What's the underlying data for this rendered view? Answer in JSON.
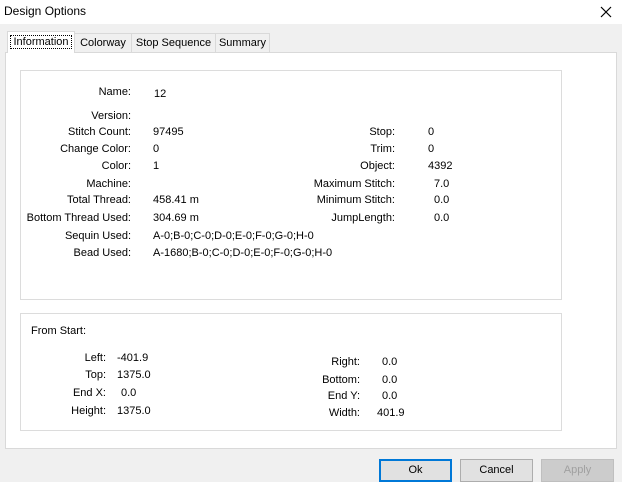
{
  "window": {
    "title": "Design Options"
  },
  "tabs": [
    {
      "label": "Information"
    },
    {
      "label": "Colorway"
    },
    {
      "label": "Stop Sequence"
    },
    {
      "label": "Summary"
    }
  ],
  "info": {
    "name_label": "Name:",
    "name_value": "12",
    "version_label": "Version:",
    "version_value": "",
    "stitch_count_label": "Stitch Count:",
    "stitch_count_value": "97495",
    "change_color_label": "Change Color:",
    "change_color_value": "0",
    "color_label": "Color:",
    "color_value": "1",
    "machine_label": "Machine:",
    "machine_value": "",
    "total_thread_label": "Total Thread:",
    "total_thread_value": "458.41 m",
    "bottom_thread_label": "Bottom Thread Used:",
    "bottom_thread_value": "304.69 m",
    "sequin_label": "Sequin Used:",
    "sequin_value": "A-0;B-0;C-0;D-0;E-0;F-0;G-0;H-0",
    "bead_label": "Bead Used:",
    "bead_value": "A-1680;B-0;C-0;D-0;E-0;F-0;G-0;H-0",
    "stop_label": "Stop:",
    "stop_value": "0",
    "trim_label": "Trim:",
    "trim_value": "0",
    "object_label": "Object:",
    "object_value": "4392",
    "max_stitch_label": "Maximum Stitch:",
    "max_stitch_value": "7.0",
    "min_stitch_label": "Minimum Stitch:",
    "min_stitch_value": "0.0",
    "jump_length_label": "JumpLength:",
    "jump_length_value": "0.0"
  },
  "from_start": {
    "heading": "From Start:",
    "left_label": "Left:",
    "left_value": "-401.9",
    "top_label": "Top:",
    "top_value": "1375.0",
    "endx_label": "End X:",
    "endx_value": "0.0",
    "height_label": "Height:",
    "height_value": "1375.0",
    "right_label": "Right:",
    "right_value": "0.0",
    "bottom_label": "Bottom:",
    "bottom_value": "0.0",
    "endy_label": "End Y:",
    "endy_value": "0.0",
    "width_label": "Width:",
    "width_value": "401.9"
  },
  "buttons": {
    "ok": "Ok",
    "cancel": "Cancel",
    "apply": "Apply"
  }
}
